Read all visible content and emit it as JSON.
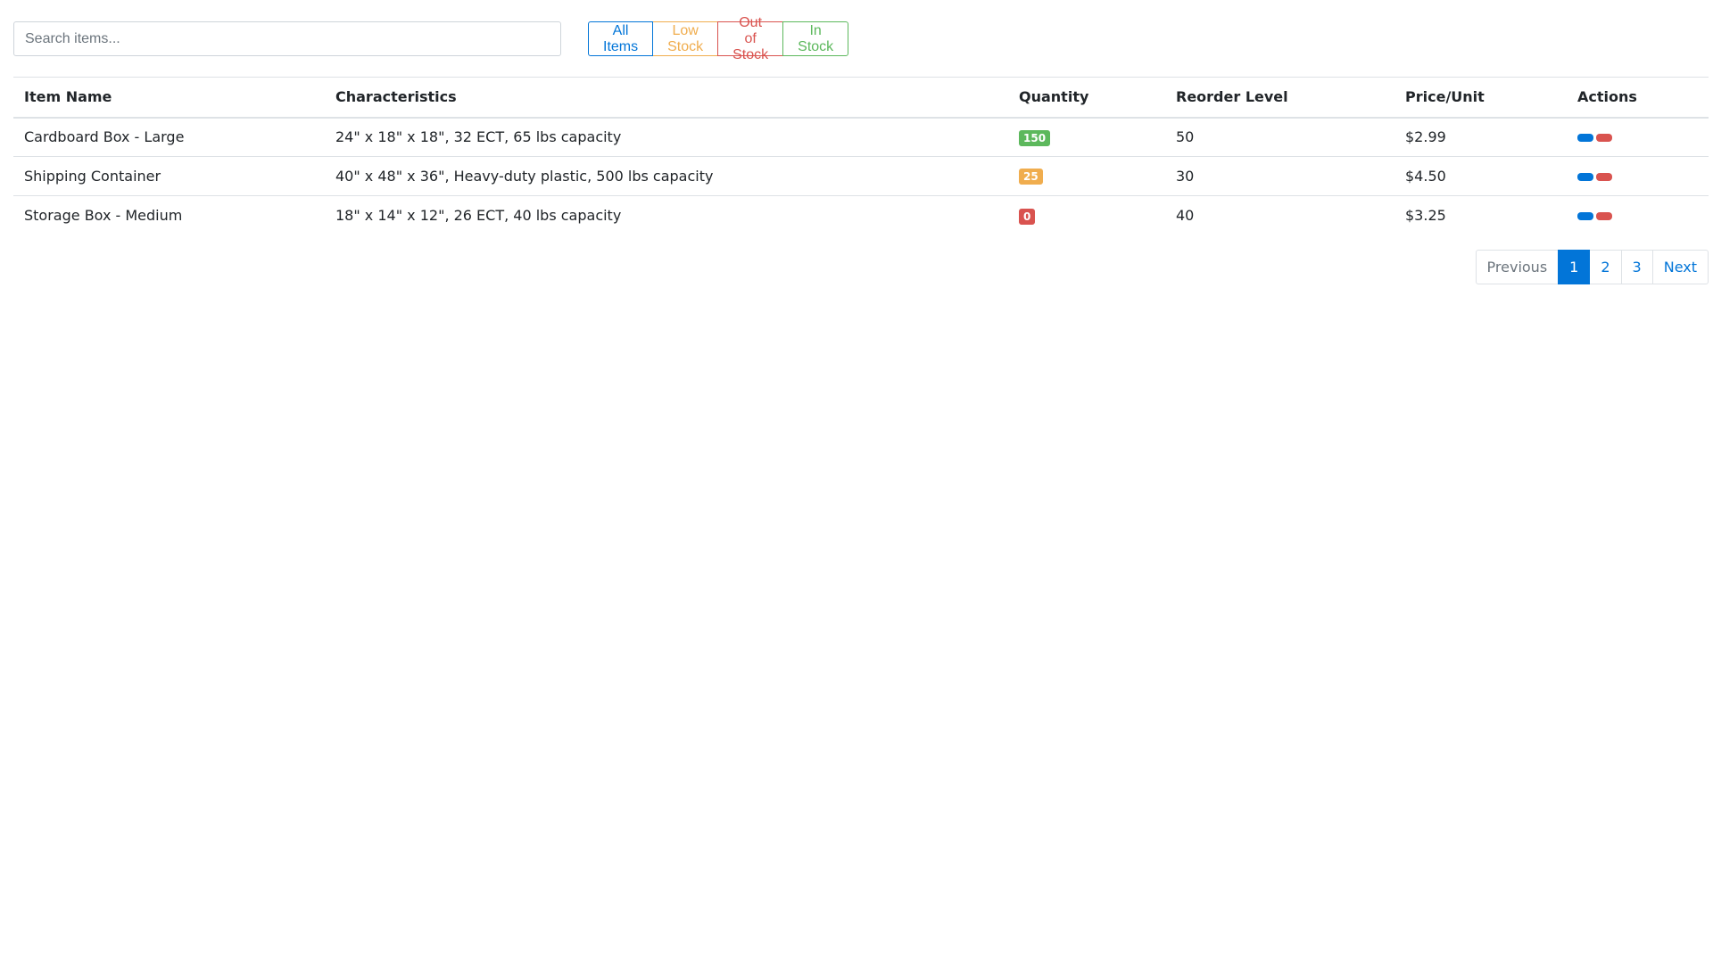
{
  "search": {
    "placeholder": "Search items...",
    "value": ""
  },
  "filters": [
    {
      "label": "All Items",
      "color": "#0275d8",
      "active": true
    },
    {
      "label": "Low Stock",
      "color": "#f0ad4e",
      "active": false
    },
    {
      "label": "Out of Stock",
      "color": "#d9534f",
      "active": false
    },
    {
      "label": "In Stock",
      "color": "#5cb85c",
      "active": false
    }
  ],
  "table": {
    "columns": [
      "Item Name",
      "Characteristics",
      "Quantity",
      "Reorder Level",
      "Price/Unit",
      "Actions"
    ],
    "rows": [
      {
        "name": "Cardboard Box - Large",
        "characteristics": "24\" x 18\" x 18\", 32 ECT, 65 lbs capacity",
        "quantity": "150",
        "quantity_color": "#5cb85c",
        "reorder": "50",
        "price": "$2.99"
      },
      {
        "name": "Shipping Container",
        "characteristics": "40\" x 48\" x 36\", Heavy-duty plastic, 500 lbs capacity",
        "quantity": "25",
        "quantity_color": "#f0ad4e",
        "reorder": "30",
        "price": "$4.50"
      },
      {
        "name": "Storage Box - Medium",
        "characteristics": "18\" x 14\" x 12\", 26 ECT, 40 lbs capacity",
        "quantity": "0",
        "quantity_color": "#d9534f",
        "reorder": "40",
        "price": "$3.25"
      }
    ],
    "action_colors": {
      "edit": "#0275d8",
      "delete": "#d9534f"
    }
  },
  "pagination": {
    "previous_label": "Previous",
    "pages": [
      "1",
      "2",
      "3"
    ],
    "current": "1",
    "next_label": "Next",
    "active_color": "#0275d8",
    "link_color": "#0275d8",
    "disabled_color": "#6c757d"
  }
}
